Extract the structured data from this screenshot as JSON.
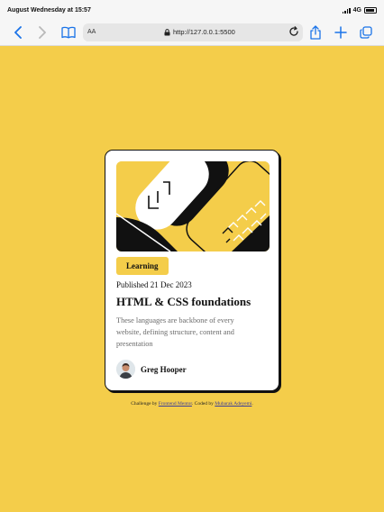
{
  "status_bar": {
    "time": "August Wednesday at 15:57",
    "network": "4G"
  },
  "browser": {
    "text_size_label": "AA",
    "url": "http://127.0.0.1:5500"
  },
  "card": {
    "tag": "Learning",
    "published": "Published 21 Dec 2023",
    "title": "HTML & CSS foundations",
    "description": "These languages are backbone of every website, defining structure, content and presentation",
    "author": "Greg Hooper"
  },
  "attribution": {
    "prefix": "Challenge by",
    "challenge_link": "Frontend Mentor",
    "middle": ". Coded by",
    "coder_link": "Mubarak Adeyemi",
    "suffix": "."
  },
  "colors": {
    "background": "#f4cd4a",
    "card": "#ffffff",
    "text": "#111111",
    "muted": "#6b6b6b",
    "link": "#3b3d99",
    "browser_accent": "#1a73e8"
  }
}
